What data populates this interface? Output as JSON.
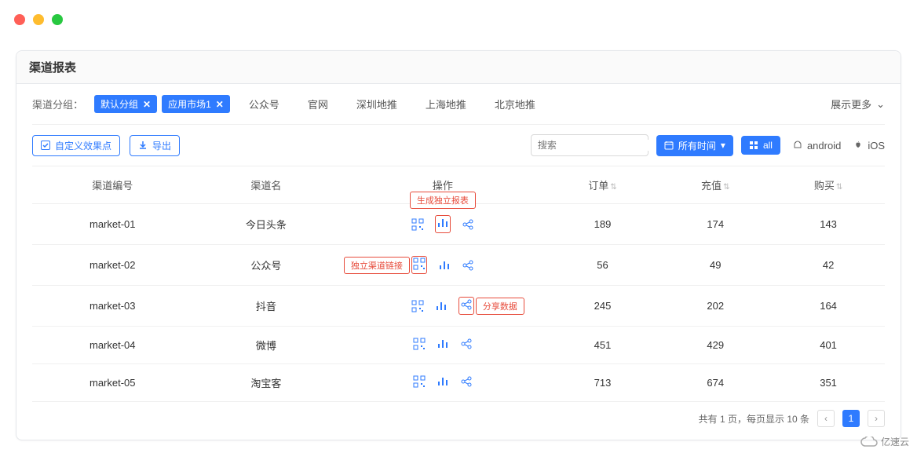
{
  "page_title": "渠道报表",
  "filter": {
    "label": "渠道分组：",
    "active_tags": [
      "默认分组",
      "应用市场1"
    ],
    "groups": [
      "公众号",
      "官网",
      "深圳地推",
      "上海地推",
      "北京地推"
    ],
    "more": "展示更多"
  },
  "toolbar": {
    "custom_points": "自定义效果点",
    "export": "导出",
    "search_placeholder": "搜索",
    "time_label": "所有时间",
    "platform_all": "all",
    "platform_android": "android",
    "platform_ios": "iOS"
  },
  "table": {
    "headers": {
      "channel_id": "渠道编号",
      "channel_name": "渠道名",
      "actions": "操作",
      "orders": "订单",
      "recharge": "充值",
      "purchase": "购买"
    },
    "callouts": {
      "report": "生成独立报表",
      "link": "独立渠道链接",
      "share": "分享数据"
    },
    "rows": [
      {
        "id": "market-01",
        "name": "今日头条",
        "orders": "189",
        "recharge": "174",
        "purchase": "143"
      },
      {
        "id": "market-02",
        "name": "公众号",
        "orders": "56",
        "recharge": "49",
        "purchase": "42"
      },
      {
        "id": "market-03",
        "name": "抖音",
        "orders": "245",
        "recharge": "202",
        "purchase": "164"
      },
      {
        "id": "market-04",
        "name": "微博",
        "orders": "451",
        "recharge": "429",
        "purchase": "401"
      },
      {
        "id": "market-05",
        "name": "淘宝客",
        "orders": "713",
        "recharge": "674",
        "purchase": "351"
      }
    ]
  },
  "pagination": {
    "summary": "共有 1 页，每页显示 10 条",
    "current": "1"
  },
  "watermark": "亿速云"
}
